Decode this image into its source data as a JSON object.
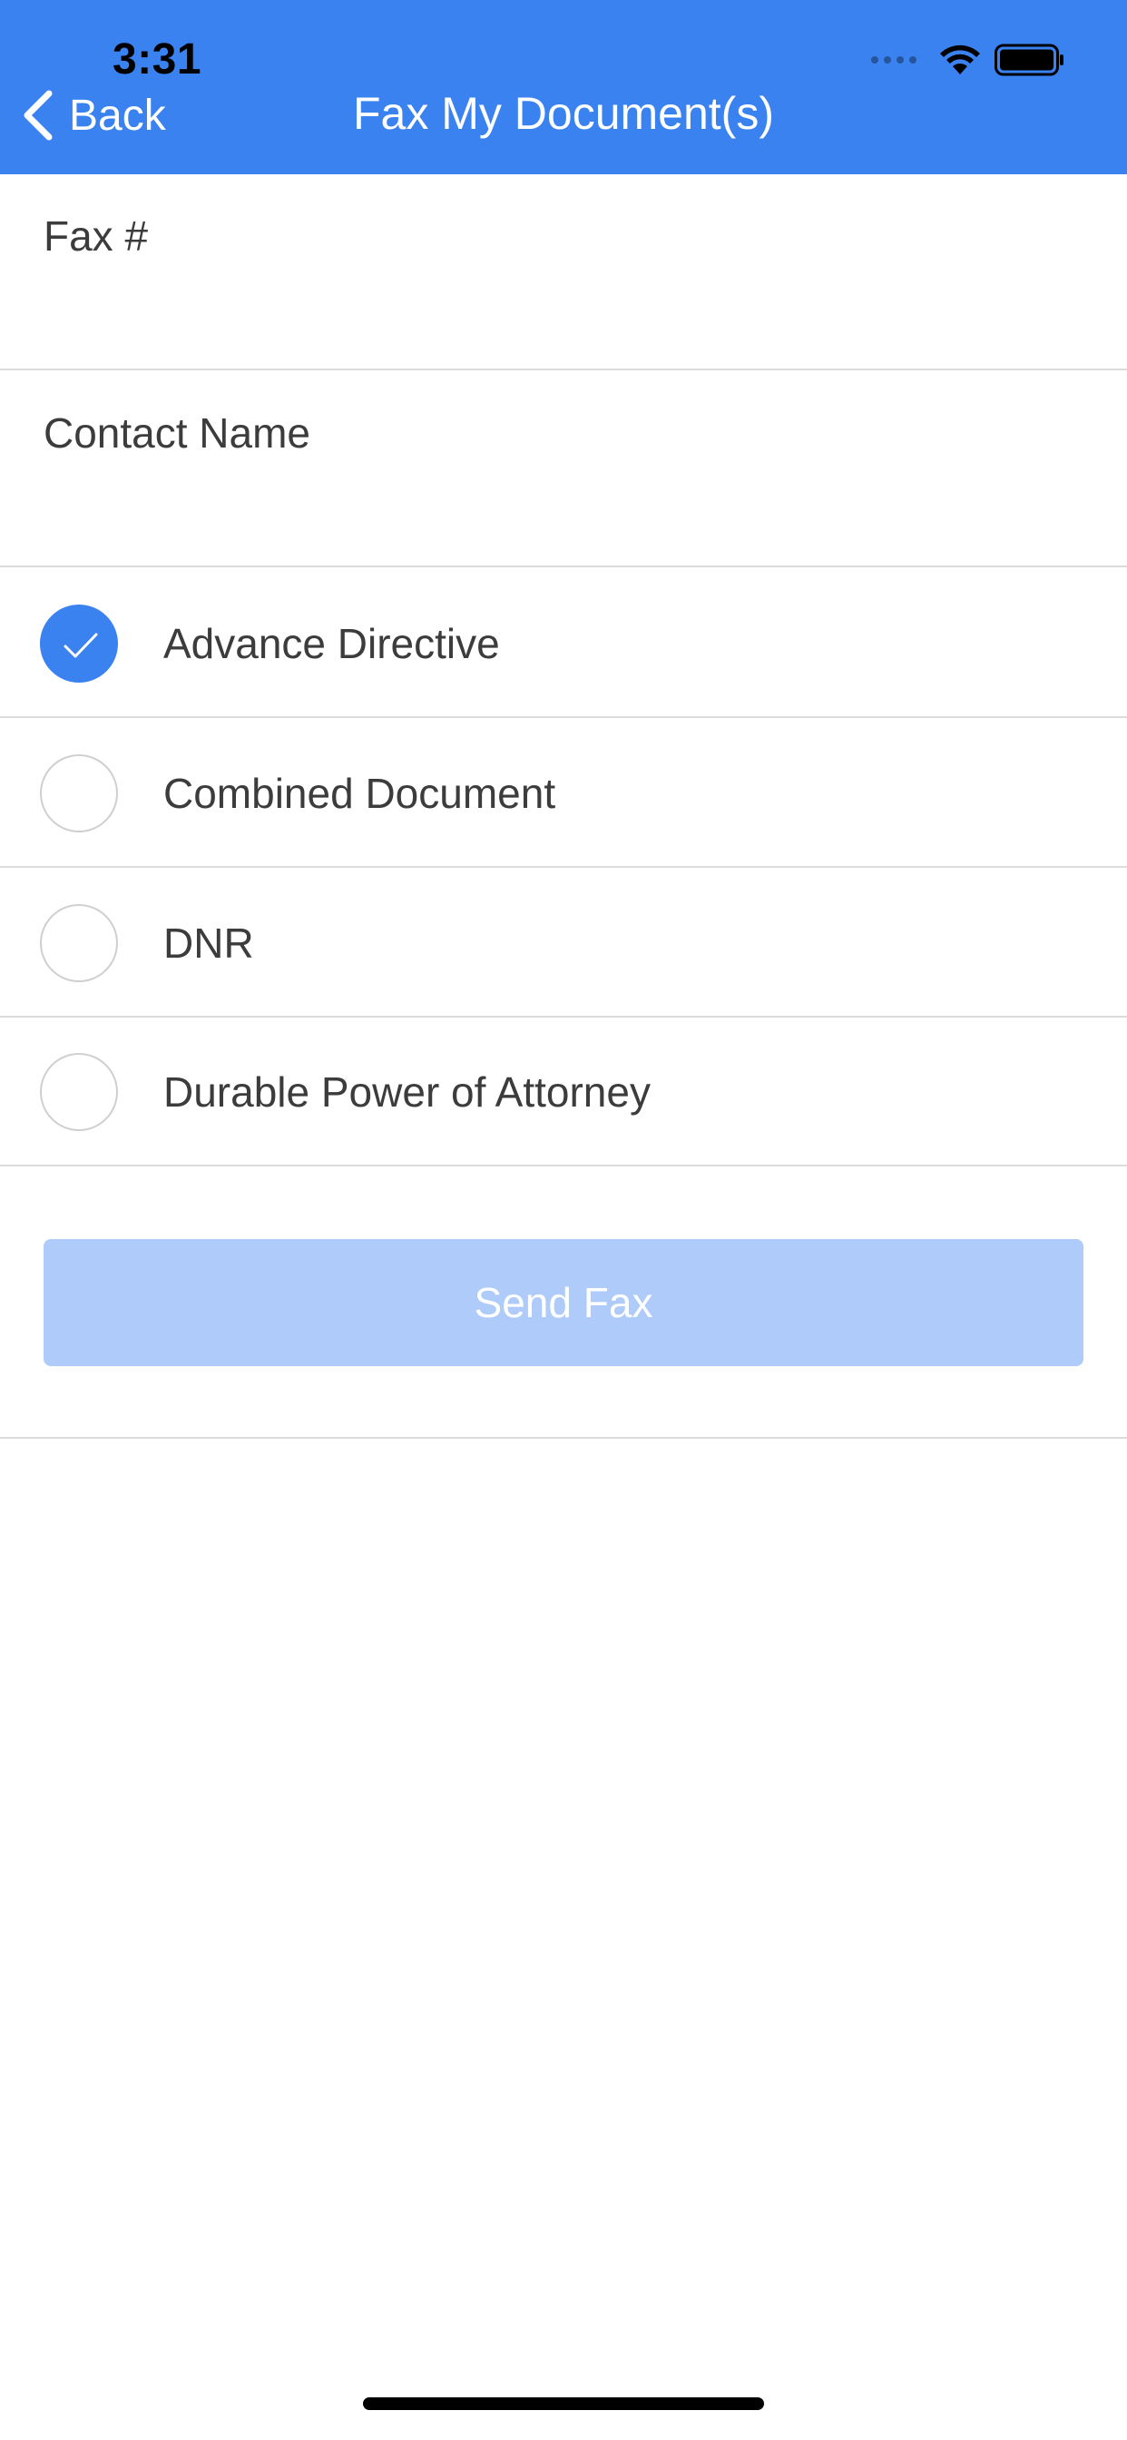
{
  "status_bar": {
    "time": "3:31",
    "icons": [
      "signal-dots-icon",
      "wifi-icon",
      "battery-icon"
    ]
  },
  "nav": {
    "back_label": "Back",
    "title": "Fax My Document(s)"
  },
  "form": {
    "fax_label": "Fax #",
    "fax_value": "",
    "contact_label": "Contact Name",
    "contact_value": ""
  },
  "documents": [
    {
      "label": "Advance Directive",
      "selected": true
    },
    {
      "label": "Combined Document",
      "selected": false
    },
    {
      "label": "DNR",
      "selected": false
    },
    {
      "label": "Durable Power of Attorney",
      "selected": false
    }
  ],
  "send_button": {
    "label": "Send Fax",
    "enabled": false
  },
  "colors": {
    "accent": "#3b82f1",
    "button_disabled": "#aecbf9",
    "divider": "#dcdcdc",
    "text": "#3c3c3c"
  }
}
